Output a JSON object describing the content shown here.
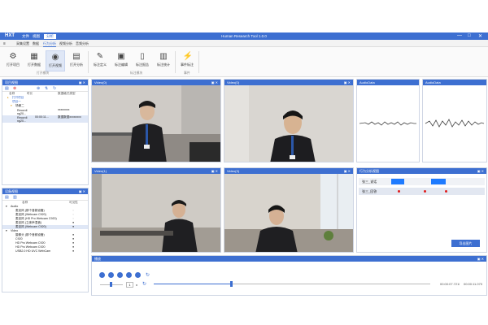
{
  "app": {
    "logo": "HXT",
    "menus": [
      "文件",
      "视图",
      "分析"
    ],
    "title": "Human Research Tool 1.0.0",
    "window_buttons": [
      "—",
      "□",
      "✕"
    ]
  },
  "submenu": {
    "items": [
      "采集设置",
      "数据",
      "行为分析",
      "视频分析",
      "音频分析"
    ],
    "active_index": 2
  },
  "ribbon": {
    "buttons": [
      {
        "label": "打开项目",
        "icon": "gear-icon"
      },
      {
        "label": "打开数据",
        "icon": "data-icon"
      },
      {
        "label": "打开视频",
        "icon": "video-icon"
      },
      {
        "label": "打开分析",
        "icon": "chart-icon"
      },
      {
        "label": "标注定义",
        "icon": "pen-icon"
      },
      {
        "label": "标注编辑",
        "icon": "terminal-icon"
      },
      {
        "label": "标注报告",
        "icon": "document-icon"
      },
      {
        "label": "标注统计",
        "icon": "table-icon"
      },
      {
        "label": "事件标注",
        "icon": "lightning-icon"
      }
    ],
    "groups": [
      "打开模块",
      "标注模块",
      "事件"
    ]
  },
  "project_panel": {
    "title": "项目视图",
    "columns": [
      "名称",
      "时长",
      "数据格式类型"
    ],
    "rows": [
      {
        "name": "打开项目",
        "duration": "",
        "type": ""
      },
      {
        "name": "项目一",
        "duration": "",
        "type": ""
      },
      {
        "name": "场景二",
        "duration": "",
        "type": ""
      },
      {
        "name": "Recordi ng20...",
        "duration": "",
        "type": "xxxxxxxx"
      },
      {
        "name": "Recordi ng20...",
        "duration": "00:00:11...",
        "type": "数据数据xxxxxxxx"
      }
    ]
  },
  "device_panel": {
    "title": "设备视图",
    "columns": [
      "名称",
      "可见性"
    ],
    "audio_label": "Audio",
    "audio_items": [
      "麦克风 (那个音频设备)",
      "麦克风 (Webcam C920)",
      "麦克风 (HD Pro Webcam C920)",
      "麦克风 (立体声混音)",
      "麦克风 (Webcam C920)"
    ],
    "video_label": "Video",
    "video_items": [
      "摄像头 (那个音频设备)",
      "C920",
      "HD Pro Webcam C920",
      "HD Pro Webcam C920",
      "USB2.0 HD UVC WebCam"
    ]
  },
  "videos": [
    {
      "title": "Video(0)"
    },
    {
      "title": "Video(0)"
    },
    {
      "title": "Video(1)"
    },
    {
      "title": "Video(3)"
    }
  ],
  "audios": [
    {
      "title": "AudioData"
    },
    {
      "title": "AudioData"
    }
  ],
  "behavior": {
    "title": "行为分析视图",
    "rows": [
      "张三_说话",
      "张三_回答"
    ],
    "export_label": "导出图片"
  },
  "player": {
    "title": "播放",
    "speed": "1",
    "speed_unit": "x",
    "time": "00:00:07.721",
    "separator": "/",
    "total": "00:00:11.070",
    "progress": 0.28
  },
  "colors": {
    "accent": "#3d6fd1",
    "marker_blue": "#1e7bff",
    "marker_red": "#e01c1c"
  }
}
